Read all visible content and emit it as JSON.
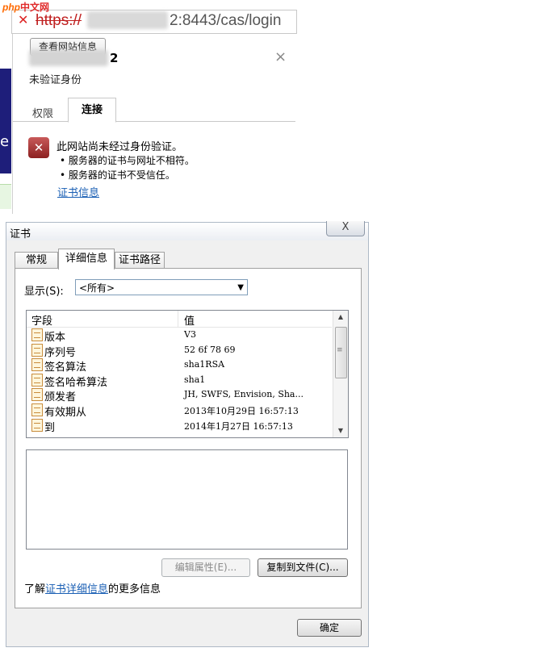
{
  "logo": {
    "part1": "php",
    "part2": "中文网"
  },
  "browser": {
    "url_scheme": "https://",
    "url_rest": "2:8443/cas/login",
    "site_info_button": "查看网站信息",
    "host_suffix": "2",
    "close_symbol": "×",
    "identity_status": "未验证身份",
    "tabs": {
      "permissions": "权限",
      "connection": "连接"
    },
    "warning_title": "此网站尚未经过身份验证。",
    "warnings": [
      "• 服务器的证书与网址不相符。",
      "• 服务器的证书不受信任。"
    ],
    "cert_info_link": "证书信息",
    "strip_letter": "e"
  },
  "dialog": {
    "title": "证书",
    "close_symbol": "X",
    "tabs": [
      "常规",
      "详细信息",
      "证书路径"
    ],
    "show_label": "显示(S):",
    "show_value": "<所有>",
    "columns": {
      "field": "字段",
      "value": "值"
    },
    "rows": [
      {
        "field": "版本",
        "value": "V3"
      },
      {
        "field": "序列号",
        "value": "52 6f 78 69"
      },
      {
        "field": "签名算法",
        "value": "sha1RSA"
      },
      {
        "field": "签名哈希算法",
        "value": "sha1"
      },
      {
        "field": "颁发者",
        "value": "JH, SWFS, Envision, Sha..."
      },
      {
        "field": "有效期从",
        "value": "2013年10月29日 16:57:13"
      },
      {
        "field": "到",
        "value": "2014年1月27日 16:57:13"
      }
    ],
    "edit_properties_button": "编辑属性(E)...",
    "copy_to_file_button": "复制到文件(C)...",
    "learn_more_prefix": "了解",
    "learn_more_link": "证书详细信息",
    "learn_more_suffix": "的更多信息",
    "ok_button": "确定"
  }
}
